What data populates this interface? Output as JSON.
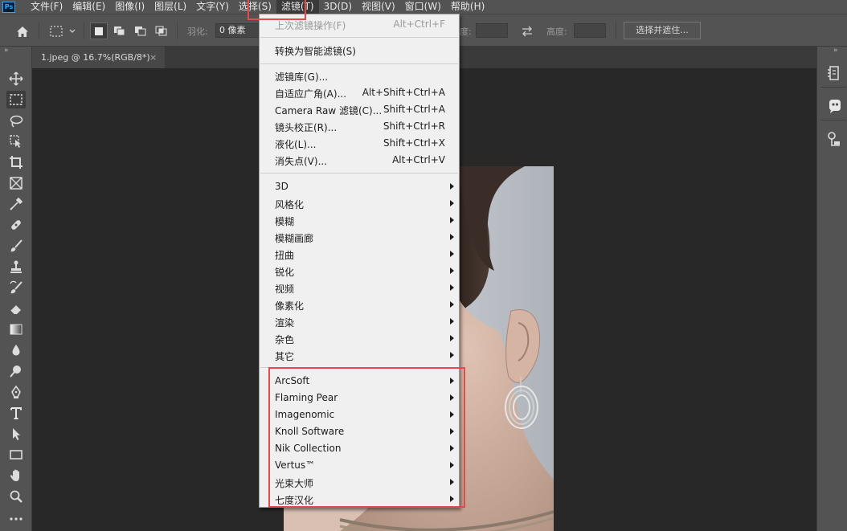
{
  "menubar": {
    "logo": "Ps",
    "items": [
      {
        "label": "文件(F)"
      },
      {
        "label": "编辑(E)"
      },
      {
        "label": "图像(I)"
      },
      {
        "label": "图层(L)"
      },
      {
        "label": "文字(Y)"
      },
      {
        "label": "选择(S)"
      },
      {
        "label": "滤镜(T)"
      },
      {
        "label": "3D(D)"
      },
      {
        "label": "视图(V)"
      },
      {
        "label": "窗口(W)"
      },
      {
        "label": "帮助(H)"
      }
    ]
  },
  "options": {
    "feather_label": "羽化:",
    "feather_value": "0 像素",
    "width_label": "度:",
    "height_label": "高度:",
    "select_mask_label": "选择并遮住..."
  },
  "document_tab": {
    "title": "1.jpeg @ 16.7%(RGB/8*)",
    "close": "×"
  },
  "filter_menu": {
    "items": [
      {
        "label": "上次滤镜操作(F)",
        "shortcut": "Alt+Ctrl+F",
        "disabled": true
      },
      {
        "label": "转换为智能滤镜(S)",
        "shortcut": ""
      },
      {
        "label": "滤镜库(G)...",
        "shortcut": ""
      },
      {
        "label": "自适应广角(A)...",
        "shortcut": "Alt+Shift+Ctrl+A"
      },
      {
        "label": "Camera Raw 滤镜(C)...",
        "shortcut": "Shift+Ctrl+A"
      },
      {
        "label": "镜头校正(R)...",
        "shortcut": "Shift+Ctrl+R"
      },
      {
        "label": "液化(L)...",
        "shortcut": "Shift+Ctrl+X"
      },
      {
        "label": "消失点(V)...",
        "shortcut": "Alt+Ctrl+V"
      },
      {
        "label": "3D",
        "submenu": true
      },
      {
        "label": "风格化",
        "submenu": true
      },
      {
        "label": "模糊",
        "submenu": true
      },
      {
        "label": "模糊画廊",
        "submenu": true
      },
      {
        "label": "扭曲",
        "submenu": true
      },
      {
        "label": "锐化",
        "submenu": true
      },
      {
        "label": "视频",
        "submenu": true
      },
      {
        "label": "像素化",
        "submenu": true
      },
      {
        "label": "渲染",
        "submenu": true
      },
      {
        "label": "杂色",
        "submenu": true
      },
      {
        "label": "其它",
        "submenu": true
      },
      {
        "label": "ArcSoft",
        "submenu": true
      },
      {
        "label": "Flaming Pear",
        "submenu": true
      },
      {
        "label": "Imagenomic",
        "submenu": true
      },
      {
        "label": "Knoll Software",
        "submenu": true
      },
      {
        "label": "Nik Collection",
        "submenu": true
      },
      {
        "label": "Vertus™",
        "submenu": true
      },
      {
        "label": "光束大师",
        "submenu": true
      },
      {
        "label": "七度汉化",
        "submenu": true
      }
    ]
  },
  "colors": {
    "highlight": "#e24b4b",
    "menu_bg": "#f0f0f0",
    "chrome": "#535353",
    "canvas": "#282828"
  }
}
